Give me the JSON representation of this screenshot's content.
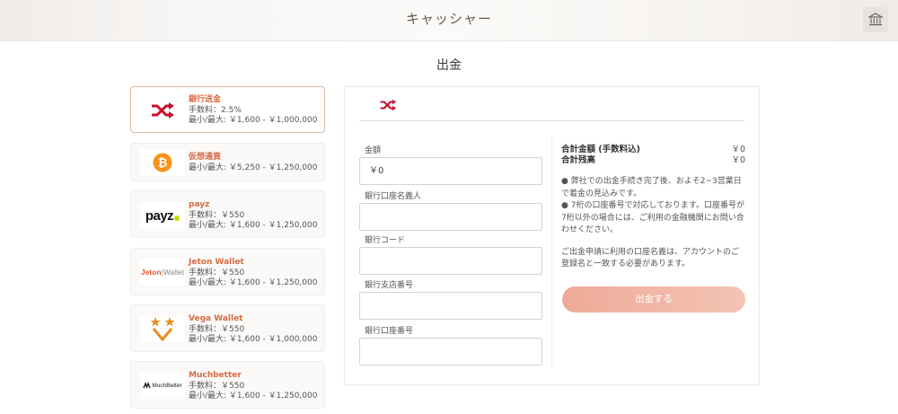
{
  "header": {
    "title": "キャッシャー",
    "bank_icon": "bank-icon"
  },
  "page": {
    "title": "出金"
  },
  "methods": [
    {
      "name": "銀行送金",
      "fee": "手数料：2.5%",
      "limits": "最小/最大: ￥1,600 - ￥1,000,000",
      "icon": "shuffle-icon"
    },
    {
      "name": "仮想通貨",
      "limits": "最小/最大: ￥5,250 - ￥1,250,000",
      "icon": "bitcoin-icon"
    },
    {
      "name": "payz",
      "fee": "手数料：￥550",
      "limits": "最小/最大: ￥1,600 - ￥1,250,000",
      "logo_text": "payz"
    },
    {
      "name": "Jeton Wallet",
      "fee": "手数料：￥550",
      "limits": "最小/最大: ￥1,600 - ￥1,250,000",
      "logo_text_1": "Jeton",
      "logo_text_2": "Wallet"
    },
    {
      "name": "Vega Wallet",
      "fee": "手数料：￥550",
      "limits": "最小/最大: ￥1,600 - ￥1,000,000",
      "icon": "vega-wallet-icon"
    },
    {
      "name": "Muchbetter",
      "fee": "手数料：￥550",
      "limits": "最小/最大: ￥1,600 - ￥1,250,000",
      "logo_text": "MuchBetter"
    }
  ],
  "form": {
    "amount_label": "金額",
    "amount_value": "￥0",
    "holder_label": "銀行口座名義人",
    "holder_value": "",
    "code_label": "銀行コード",
    "code_value": "",
    "branch_label": "銀行支店番号",
    "branch_value": "",
    "account_label": "銀行口座番号",
    "account_value": ""
  },
  "summary": {
    "total_label": "合計金額 (手数料込)",
    "total_value": "￥0",
    "balance_label": "合計残高",
    "balance_value": "￥0",
    "note1": "● 弊社での出金手続き完了後、およそ2~3営業日で着金の見込みです。",
    "note2": "● 7桁の口座番号で対応しております。口座番号が7桁以外の場合には、ご利用の金融機関にお問い合わせください。",
    "note3": "ご出金申請に利用の口座名義は、アカウントのご登録名と一致する必要があります。",
    "submit_label": "出金する"
  },
  "colors": {
    "accent": "#d56c44",
    "button": "#f0b2a0",
    "shuffle_red": "#c8102e"
  }
}
